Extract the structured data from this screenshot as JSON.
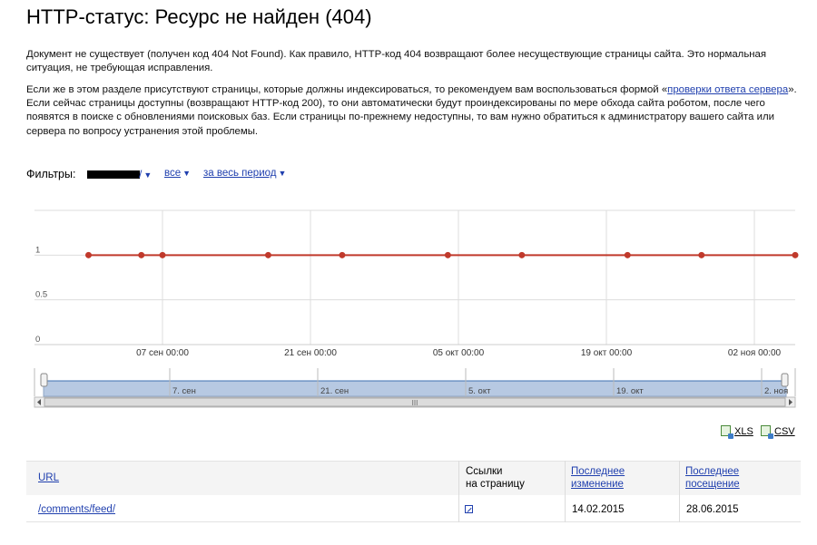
{
  "page": {
    "title": "HTTP-статус: Ресурс не найден (404)",
    "paragraph1": "Документ не существует (получен код 404 Not Found). Как правило, HTTP-код 404 возвращают более несуществующие страницы сайта. Это нормальная ситуация, не требующая исправления.",
    "paragraph2_before": "Если же в этом разделе присутствуют страницы, которые должны индексироваться, то рекомендуем вам воспользоваться формой «",
    "paragraph2_link": "проверки ответа сервера",
    "paragraph2_after": "». Если сейчас страницы доступны (возвращают HTTP-код 200), то они автоматически будут проиндексированы по мере обхода сайта роботом, после чего появятся в поиске с обновлениями поисковых баз. Если страницы по-прежнему недоступны, то вам нужно обратиться к администратору вашего сайта или сервера по вопросу устранения этой проблемы."
  },
  "filters": {
    "label": "Фильтры:",
    "path_suffix": "/",
    "scope": "все",
    "period": "за весь период"
  },
  "chart_data": {
    "type": "line",
    "y_ticks": [
      "0",
      "0.5",
      "1"
    ],
    "ylim": [
      0,
      1.5
    ],
    "x_tick_labels": [
      "07 сен 00:00",
      "21 сен 00:00",
      "05 окт 00:00",
      "19 окт 00:00",
      "02 ноя 00:00"
    ],
    "navigator_labels": [
      "7. сен",
      "21. сен",
      "5. окт",
      "19. окт",
      "2. ноя"
    ],
    "navigator_scroll_label": "III",
    "series": [
      {
        "color": "#c0392b",
        "x": [
          "2015-08-31",
          "2015-09-05",
          "2015-09-07",
          "2015-09-17",
          "2015-09-24",
          "2015-10-04",
          "2015-10-11",
          "2015-10-21",
          "2015-10-28",
          "2015-11-06"
        ],
        "values": [
          1,
          1,
          1,
          1,
          1,
          1,
          1,
          1,
          1,
          1
        ]
      }
    ],
    "grid": true,
    "line_color": "#c0392b"
  },
  "exports": {
    "xls": "XLS",
    "csv": "CSV"
  },
  "table": {
    "headers": {
      "url": "URL",
      "links_line1": "Ссылки",
      "links_line2": "на страницу",
      "modified_line1": "Последнее",
      "modified_line2": "изменение",
      "visited_line1": "Последнее",
      "visited_line2": "посещение"
    },
    "rows": [
      {
        "url": "/comments/feed/",
        "modified": "14.02.2015",
        "visited": "28.06.2015"
      }
    ]
  }
}
